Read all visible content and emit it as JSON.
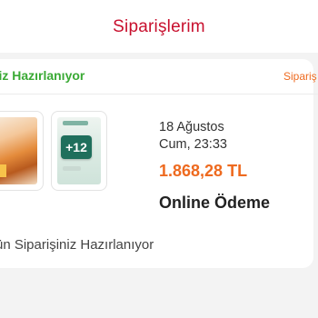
{
  "header": {
    "title": "Siparişlerim"
  },
  "order": {
    "status_label": "iniz Hazırlanıyor",
    "order_link": "Sipariş",
    "date_line_1": "18 Ağustos",
    "date_line_2": "Cum, 23:33",
    "price": "1.868,28 TL",
    "payment_method": "Online Ödeme",
    "summary": "rün Siparişiniz Hazırlanıyor",
    "thumbnail_badge": "+12"
  },
  "colors": {
    "title": "#c8102e",
    "status": "#3aaa35",
    "price": "#ee6a1f",
    "link": "#ee6a1f"
  }
}
